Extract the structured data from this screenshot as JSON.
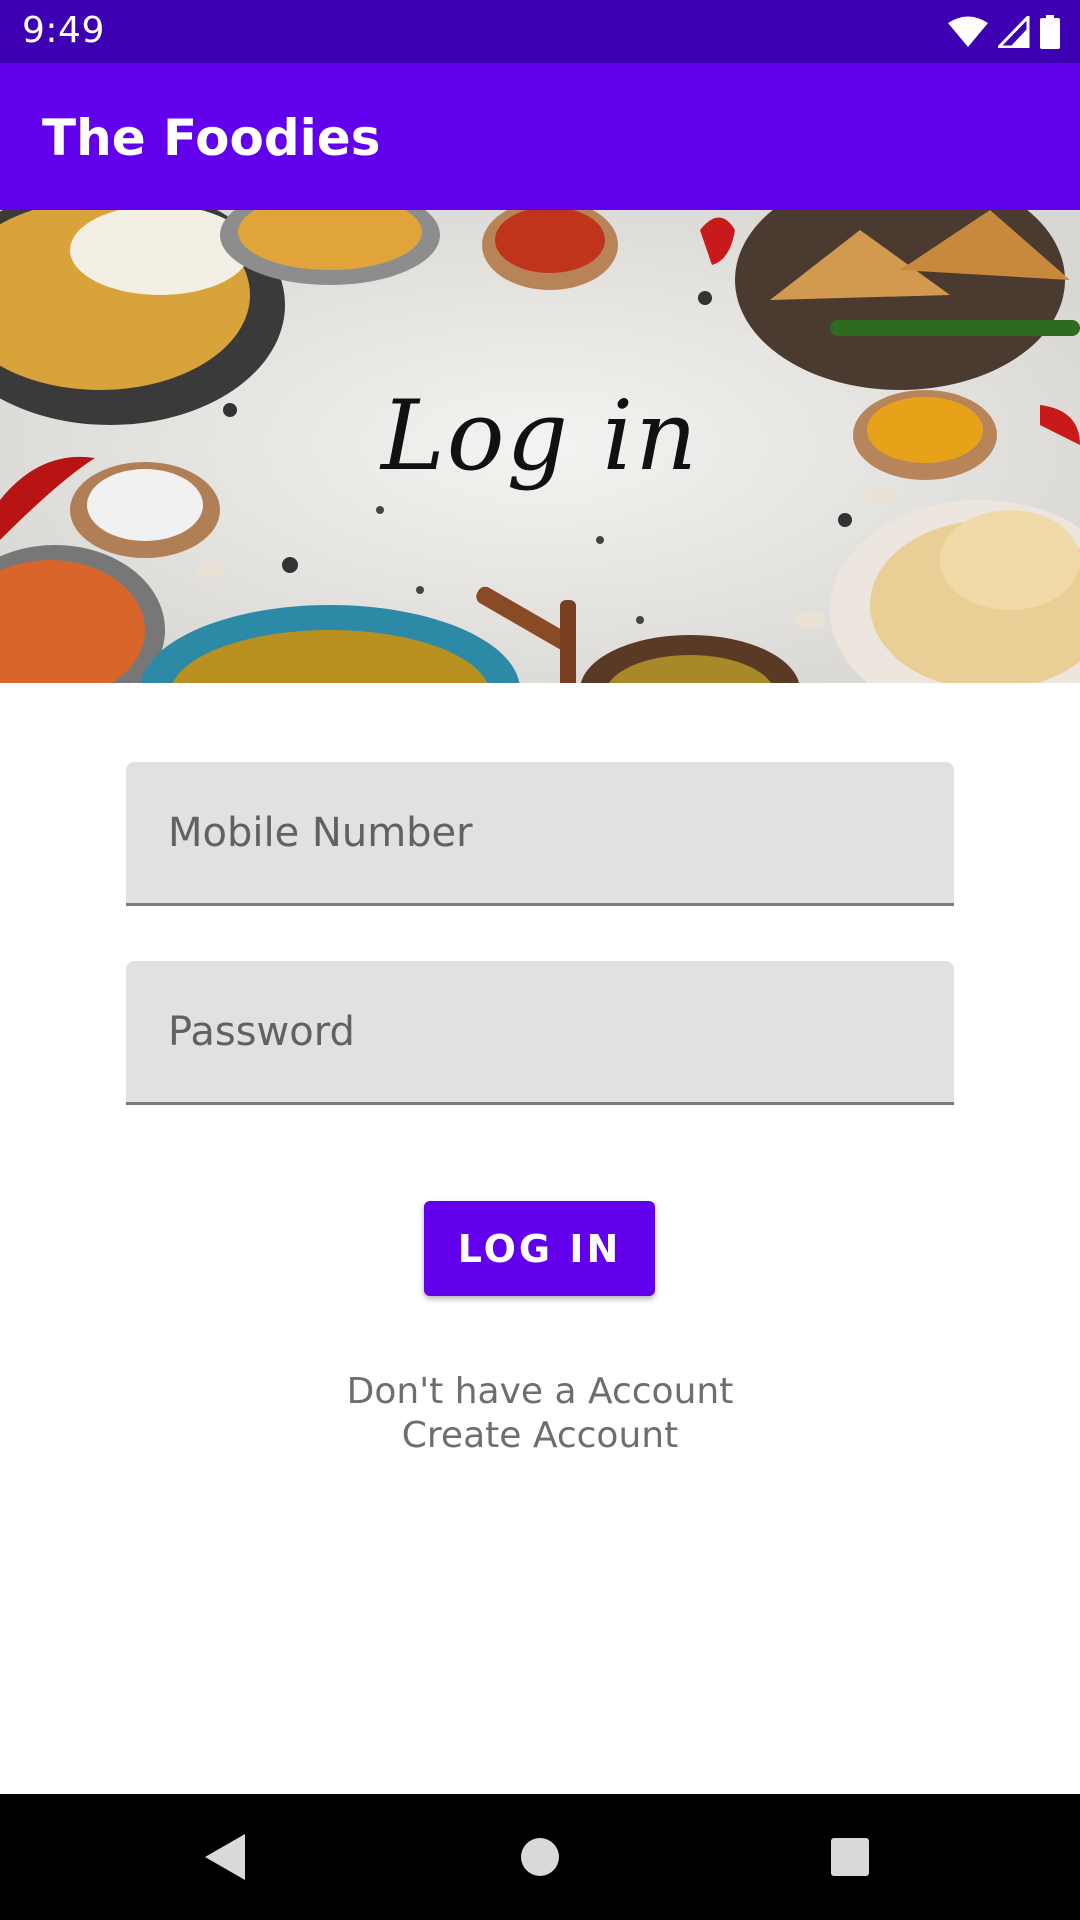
{
  "status_bar": {
    "time": "9:49",
    "icons": [
      "wifi-icon",
      "signal-icon",
      "battery-icon"
    ]
  },
  "app_bar": {
    "title": "The Foodies"
  },
  "banner": {
    "title": "Log in"
  },
  "form": {
    "mobile_placeholder": "Mobile Number",
    "mobile_value": "",
    "password_placeholder": "Password",
    "password_value": ""
  },
  "login_button": {
    "label": "LOG IN"
  },
  "signup": {
    "prompt": "Don't have a Account",
    "link": "Create Account"
  },
  "nav_bar": {
    "icons": [
      "back-icon",
      "home-icon",
      "recents-icon"
    ]
  },
  "colors": {
    "status_bar": "#3d00b3",
    "primary": "#6200ee",
    "field_background": "#e1e1e1",
    "secondary_text": "#6e6e6e"
  }
}
